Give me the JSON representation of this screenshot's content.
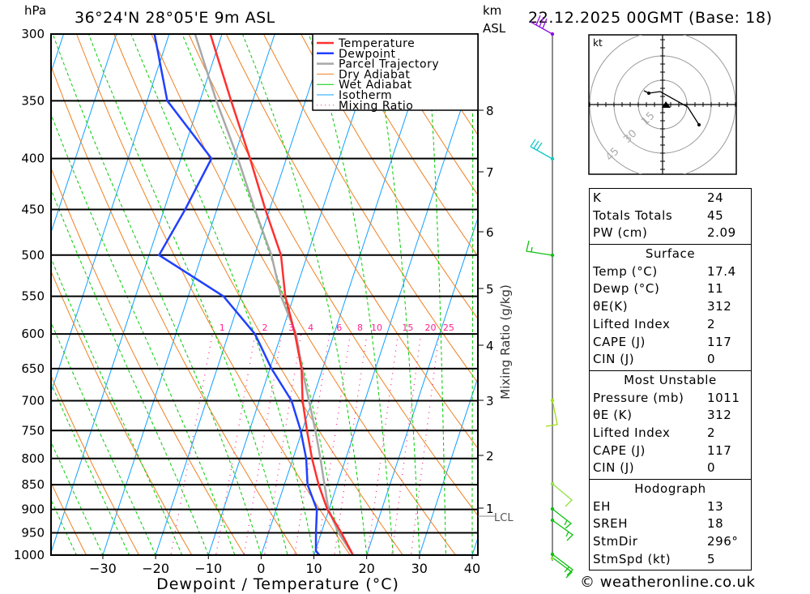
{
  "header": {
    "pressure_unit": "hPa",
    "location": "36°24'N 28°05'E 9m ASL",
    "height_unit_1": "km",
    "height_unit_2": "ASL",
    "datetime": "22.12.2025 00GMT (Base: 18)"
  },
  "chart_data": {
    "type": "line",
    "diagram": "skew-T log-P",
    "xlabel": "Dewpoint / Temperature (°C)",
    "ylabel": "hPa",
    "xlim": [
      -40,
      40
    ],
    "ylim": [
      1000,
      300
    ],
    "y_scale": "log",
    "x_ticks": [
      -30,
      -20,
      -10,
      0,
      10,
      20,
      30,
      40
    ],
    "y_ticks": [
      300,
      350,
      400,
      450,
      500,
      550,
      600,
      650,
      700,
      750,
      800,
      850,
      900,
      950,
      1000
    ],
    "height_axis": {
      "label": "km ASL",
      "ticks": [
        1,
        2,
        3,
        4,
        5,
        6,
        7,
        8
      ],
      "lcl_label": "LCL"
    },
    "mixing_ratio_axis": {
      "label": "Mixing Ratio (g/kg)",
      "values": [
        1,
        2,
        3,
        4,
        6,
        8,
        10,
        15,
        20,
        25
      ]
    },
    "legend": {
      "placement": "top-right",
      "entries": [
        {
          "name": "Temperature",
          "color": "#ff3030"
        },
        {
          "name": "Dewpoint",
          "color": "#2040ff"
        },
        {
          "name": "Parcel Trajectory",
          "color": "#a8a8a8"
        },
        {
          "name": "Dry Adiabat",
          "color": "#f08020"
        },
        {
          "name": "Wet Adiabat",
          "color": "#00cc00"
        },
        {
          "name": "Isotherm",
          "color": "#10a0ff"
        },
        {
          "name": "Mixing Ratio",
          "color": "#ff2090"
        }
      ]
    },
    "series": [
      {
        "name": "Temperature",
        "color": "#ff3030",
        "points": [
          [
            1000,
            17.4
          ],
          [
            950,
            13.8
          ],
          [
            900,
            9.7
          ],
          [
            850,
            6.5
          ],
          [
            800,
            3.6
          ],
          [
            750,
            0.9
          ],
          [
            700,
            -1.8
          ],
          [
            650,
            -4.0
          ],
          [
            600,
            -7.4
          ],
          [
            550,
            -11.6
          ],
          [
            500,
            -15.0
          ],
          [
            450,
            -20.8
          ],
          [
            400,
            -26.9
          ],
          [
            350,
            -34.1
          ],
          [
            300,
            -42.2
          ]
        ]
      },
      {
        "name": "Dewpoint",
        "color": "#2040ff",
        "points": [
          [
            1000,
            11
          ],
          [
            990,
            10.1
          ],
          [
            950,
            9.0
          ],
          [
            900,
            7.7
          ],
          [
            850,
            4.4
          ],
          [
            800,
            2.5
          ],
          [
            750,
            -0.3
          ],
          [
            700,
            -3.9
          ],
          [
            650,
            -9.7
          ],
          [
            600,
            -15.0
          ],
          [
            550,
            -23.3
          ],
          [
            500,
            -38.1
          ],
          [
            450,
            -36.0
          ],
          [
            400,
            -34.2
          ],
          [
            350,
            -46.2
          ],
          [
            300,
            -52.8
          ]
        ]
      },
      {
        "name": "Parcel Trajectory",
        "color": "#a8a8a8",
        "points": [
          [
            1000,
            17.4
          ],
          [
            950,
            13.3
          ],
          [
            900,
            9.9
          ],
          [
            850,
            7.6
          ],
          [
            800,
            5.2
          ],
          [
            750,
            2.5
          ],
          [
            700,
            -0.6
          ],
          [
            650,
            -3.9
          ],
          [
            600,
            -7.2
          ],
          [
            550,
            -12.4
          ],
          [
            500,
            -16.8
          ],
          [
            450,
            -22.8
          ],
          [
            400,
            -29.2
          ],
          [
            350,
            -36.9
          ],
          [
            300,
            -45.1
          ]
        ]
      }
    ],
    "winds": [
      {
        "p": 300,
        "color": "#9010e0"
      },
      {
        "p": 400,
        "color": "#10c8c8"
      },
      {
        "p": 500,
        "color": "#10c010"
      },
      {
        "p": 700,
        "color": "#a0e010"
      },
      {
        "p": 850,
        "color": "#90e040"
      },
      {
        "p": 900,
        "color": "#10c010"
      },
      {
        "p": 925,
        "color": "#10c010"
      },
      {
        "p": 1000,
        "color": "#10c010"
      }
    ]
  },
  "hodograph": {
    "unit": "kt",
    "rings": [
      "15",
      "30",
      "45"
    ]
  },
  "stats": {
    "indices": [
      {
        "label": "K",
        "value": "24"
      },
      {
        "label": "Totals Totals",
        "value": "45"
      },
      {
        "label": "PW (cm)",
        "value": "2.09"
      }
    ],
    "surface": {
      "title": "Surface",
      "rows": [
        {
          "label": "Temp (°C)",
          "value": "17.4"
        },
        {
          "label": "Dewp (°C)",
          "value": "11"
        },
        {
          "label": "θE(K)",
          "value": "312"
        },
        {
          "label": "Lifted Index",
          "value": "2"
        },
        {
          "label": "CAPE (J)",
          "value": "117"
        },
        {
          "label": "CIN (J)",
          "value": "0"
        }
      ]
    },
    "most_unstable": {
      "title": "Most Unstable",
      "rows": [
        {
          "label": "Pressure (mb)",
          "value": "1011"
        },
        {
          "label": "θE (K)",
          "value": "312"
        },
        {
          "label": "Lifted Index",
          "value": "2"
        },
        {
          "label": "CAPE (J)",
          "value": "117"
        },
        {
          "label": "CIN (J)",
          "value": "0"
        }
      ]
    },
    "hodograph": {
      "title": "Hodograph",
      "rows": [
        {
          "label": "EH",
          "value": "13"
        },
        {
          "label": "SREH",
          "value": "18"
        },
        {
          "label": "StmDir",
          "value": "296°"
        },
        {
          "label": "StmSpd (kt)",
          "value": "5"
        }
      ]
    }
  },
  "footer": {
    "copyright": "© weatheronline.co.uk"
  }
}
